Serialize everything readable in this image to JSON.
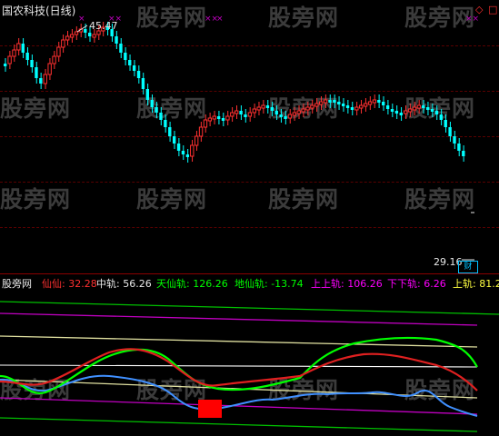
{
  "upper": {
    "title": "国农科技(日线)",
    "high_label": "45.47",
    "low_label": "29.16",
    "corner_icons": [
      "diamond-icon",
      "square-icon"
    ],
    "colors": {
      "up": "#ff3030",
      "down": "#00ffff",
      "marker": "#c000c0"
    }
  },
  "indicator": {
    "name_label": "股旁网",
    "items": [
      {
        "label": "仙仙",
        "value": "32.28",
        "color": "#ff3030"
      },
      {
        "label": "中轨",
        "value": "56.26",
        "color": "#e8e8e8"
      },
      {
        "label": "天仙轨",
        "value": "126.26",
        "color": "#00ff00"
      },
      {
        "label": "地仙轨",
        "value": "-13.74",
        "color": "#00ff00"
      },
      {
        "label": "上上轨",
        "value": "106.26",
        "color": "#ff00ff"
      },
      {
        "label": "下下轨",
        "value": "6.26",
        "color": "#ff00ff"
      },
      {
        "label": "上轨",
        "value": "81.2",
        "color": "#ffff40"
      }
    ]
  },
  "watermark": {
    "text": "股旁网"
  }
}
